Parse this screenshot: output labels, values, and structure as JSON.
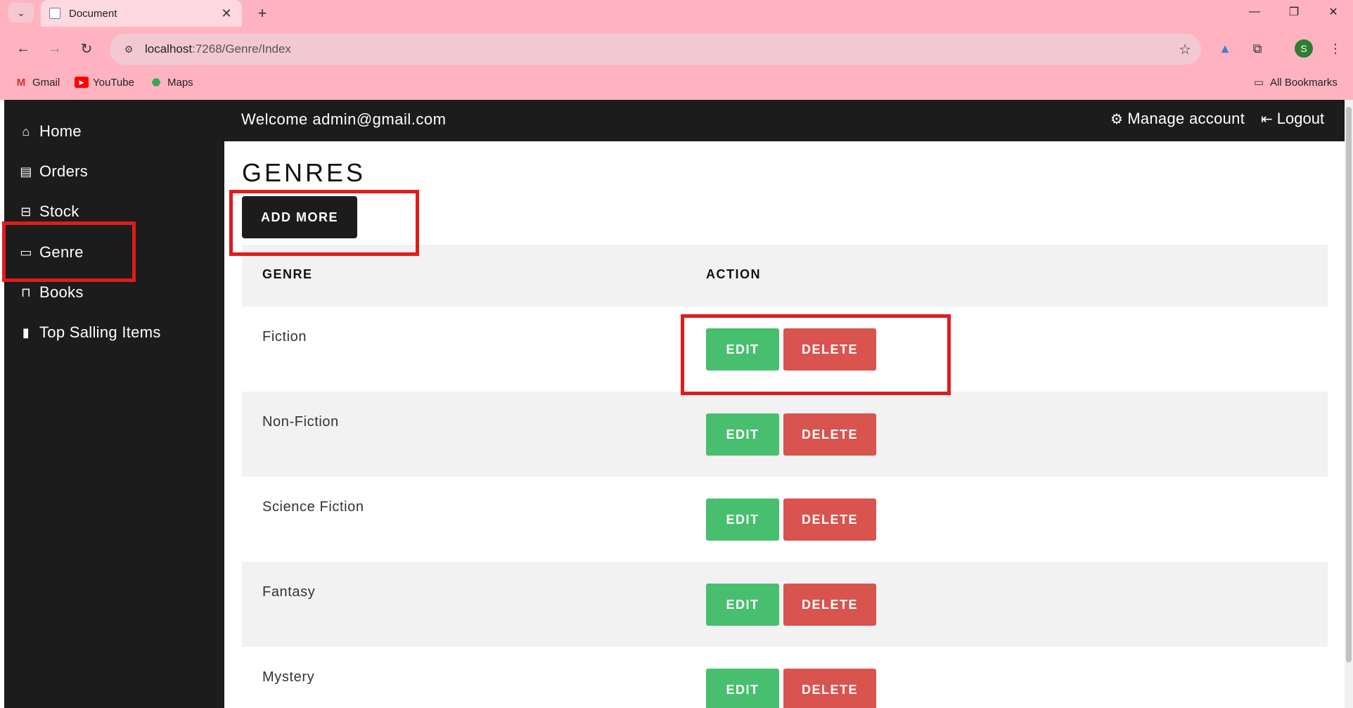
{
  "browser": {
    "tab_title": "Document",
    "tab_close": "✕",
    "new_tab": "+",
    "url_host": "localhost",
    "url_rest": ":7268/Genre/Index",
    "bookmarks": [
      {
        "label": "Gmail",
        "icon": "gmail-icon"
      },
      {
        "label": "YouTube",
        "icon": "youtube-icon"
      },
      {
        "label": "Maps",
        "icon": "maps-icon"
      }
    ],
    "all_bookmarks": "All Bookmarks",
    "avatar_letter": "S"
  },
  "topbar": {
    "welcome": "Welcome admin@gmail.com",
    "manage_account": "Manage account",
    "logout": "Logout"
  },
  "sidebar": {
    "items": [
      {
        "label": "Home",
        "icon": "home-icon"
      },
      {
        "label": "Orders",
        "icon": "orders-icon"
      },
      {
        "label": "Stock",
        "icon": "stock-icon"
      },
      {
        "label": "Genre",
        "icon": "genre-icon"
      },
      {
        "label": "Books",
        "icon": "books-icon"
      },
      {
        "label": "Top Salling Items",
        "icon": "chart-icon"
      }
    ]
  },
  "main": {
    "title": "GENRES",
    "add_button": "ADD MORE",
    "columns": [
      "GENRE",
      "ACTION"
    ],
    "rows": [
      {
        "name": "Fiction",
        "edit": "EDIT",
        "delete": "DELETE"
      },
      {
        "name": "Non-Fiction",
        "edit": "EDIT",
        "delete": "DELETE"
      },
      {
        "name": "Science Fiction",
        "edit": "EDIT",
        "delete": "DELETE"
      },
      {
        "name": "Fantasy",
        "edit": "EDIT",
        "delete": "DELETE"
      },
      {
        "name": "Mystery",
        "edit": "EDIT",
        "delete": "DELETE"
      }
    ]
  },
  "colors": {
    "chrome": "#ffb3c1",
    "dark": "#1c1c1c",
    "edit": "#48bf6f",
    "delete": "#d9534f",
    "highlight": "#e01b1b"
  }
}
